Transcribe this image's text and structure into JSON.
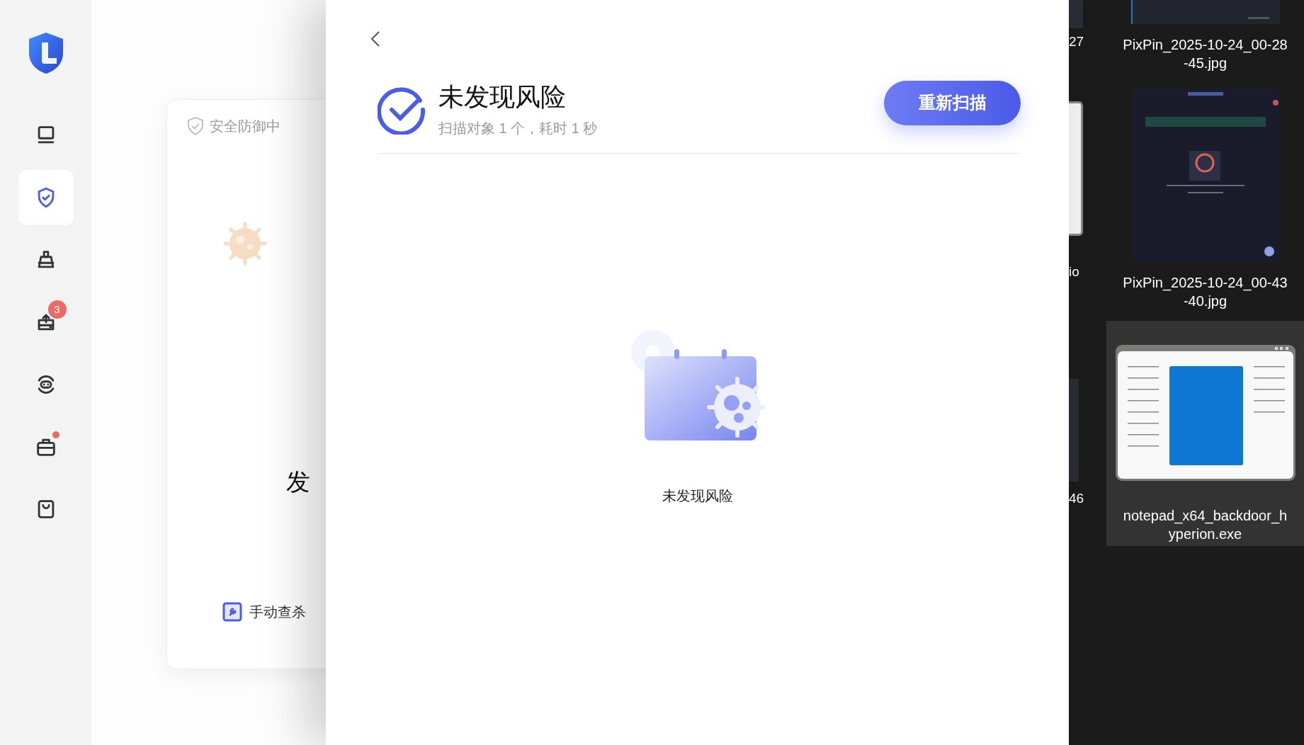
{
  "sidebar": {
    "items": [
      {
        "kind": "laptop",
        "selected": false,
        "dot": false
      },
      {
        "kind": "shield",
        "selected": true,
        "dot": false
      },
      {
        "kind": "cleaner",
        "selected": false,
        "dot": false
      },
      {
        "kind": "upload",
        "selected": false,
        "dot": false,
        "badge": "3"
      },
      {
        "kind": "chat",
        "selected": false,
        "dot": false
      },
      {
        "kind": "toolbox",
        "selected": false,
        "dot": true
      },
      {
        "kind": "bag",
        "selected": false,
        "dot": false
      }
    ]
  },
  "protection_card": {
    "status": "安全防御中",
    "headline": "发",
    "action": "手动查杀"
  },
  "scan_result": {
    "title": "未发现风险",
    "summary": "扫描对象 1 个，耗时 1 秒",
    "rescan_button": "重新扫描",
    "empty_message": "未发现风险"
  },
  "desktop": {
    "partial_labels": [
      "27",
      "io",
      "46"
    ],
    "files": [
      {
        "name": "PixPin_2025-10-24_00-28-45.jpg",
        "selected": false
      },
      {
        "name": "PixPin_2025-10-24_00-43-40.jpg",
        "selected": false
      },
      {
        "name": "notepad_x64_backdoor_hyperion.exe",
        "kind": "app",
        "selected": true
      }
    ]
  }
}
